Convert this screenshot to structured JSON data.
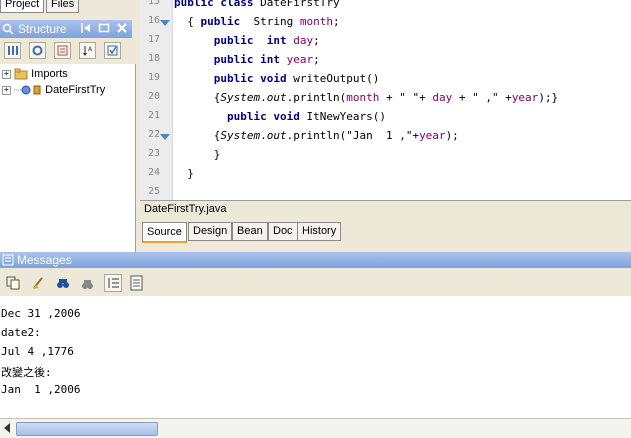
{
  "top_tabs": [
    "Project",
    "Files"
  ],
  "structure": {
    "title": "Structure",
    "tree": [
      "Imports",
      "DateFirstTry"
    ]
  },
  "editor": {
    "lines": [
      {
        "num": "15",
        "fold": false,
        "parts": [
          [
            "kw",
            "public"
          ],
          [
            "t",
            " "
          ],
          [
            "kw",
            "class"
          ],
          [
            "t",
            " DateFirstTry"
          ]
        ]
      },
      {
        "num": "16",
        "fold": true,
        "parts": [
          [
            "t",
            "  { "
          ],
          [
            "kw",
            "public"
          ],
          [
            "t",
            "  String "
          ],
          [
            "fld",
            "month"
          ],
          [
            "t",
            ";"
          ]
        ]
      },
      {
        "num": "17",
        "fold": false,
        "parts": [
          [
            "t",
            "      "
          ],
          [
            "kw",
            "public"
          ],
          [
            "t",
            "  "
          ],
          [
            "kw",
            "int"
          ],
          [
            "t",
            " "
          ],
          [
            "fld",
            "day"
          ],
          [
            "t",
            ";"
          ]
        ]
      },
      {
        "num": "18",
        "fold": false,
        "parts": [
          [
            "t",
            "      "
          ],
          [
            "kw",
            "public"
          ],
          [
            "t",
            " "
          ],
          [
            "kw",
            "int"
          ],
          [
            "t",
            " "
          ],
          [
            "fld",
            "year"
          ],
          [
            "t",
            ";"
          ]
        ]
      },
      {
        "num": "19",
        "fold": false,
        "parts": [
          [
            "t",
            "      "
          ],
          [
            "kw",
            "public"
          ],
          [
            "t",
            " "
          ],
          [
            "kw",
            "void"
          ],
          [
            "t",
            " writeOutput()"
          ]
        ]
      },
      {
        "num": "20",
        "fold": false,
        "parts": [
          [
            "t",
            "      {"
          ],
          [
            "it",
            "System"
          ],
          [
            "t",
            "."
          ],
          [
            "it",
            "out"
          ],
          [
            "t",
            ".println("
          ],
          [
            "fld",
            "month"
          ],
          [
            "t",
            " + \" \"+ "
          ],
          [
            "fld",
            "day"
          ],
          [
            "t",
            " + \" ,\" +"
          ],
          [
            "fld",
            "year"
          ],
          [
            "t",
            ");}"
          ]
        ]
      },
      {
        "num": "21",
        "fold": false,
        "parts": [
          [
            "t",
            "        "
          ],
          [
            "kw",
            "public"
          ],
          [
            "t",
            " "
          ],
          [
            "kw",
            "void"
          ],
          [
            "t",
            " ItNewYears()"
          ]
        ]
      },
      {
        "num": "22",
        "fold": true,
        "parts": [
          [
            "t",
            "      {"
          ],
          [
            "it",
            "System"
          ],
          [
            "t",
            "."
          ],
          [
            "it",
            "out"
          ],
          [
            "t",
            ".println(\"Jan  1 ,\"+"
          ],
          [
            "fld",
            "year"
          ],
          [
            "t",
            ");"
          ]
        ]
      },
      {
        "num": "23",
        "fold": false,
        "parts": [
          [
            "t",
            "      }"
          ]
        ]
      },
      {
        "num": "24",
        "fold": false,
        "parts": [
          [
            "t",
            "  }"
          ]
        ]
      },
      {
        "num": "25",
        "fold": false,
        "parts": [
          [
            "t",
            ""
          ]
        ]
      }
    ],
    "filename": "DateFirstTry.java",
    "tabs": [
      "Source",
      "Design",
      "Bean",
      "Doc",
      "History"
    ],
    "active_tab": "Source"
  },
  "messages": {
    "title": "Messages",
    "lines": [
      "Dec 31 ,2006",
      "date2:",
      "Jul 4 ,1776",
      "改變之後:",
      "Jan  1 ,2006"
    ]
  },
  "colors": {
    "panel_header": "#8aacdf",
    "keyword": "#000080",
    "field": "#880066"
  }
}
